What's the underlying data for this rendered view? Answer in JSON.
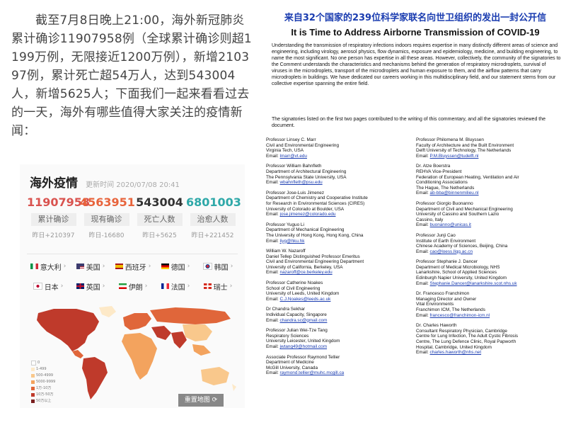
{
  "intro": "截至7月8日晚上21:00，海外新冠肺炎累计确诊11907958例（全球累计确诊则超1199万例，无限接近1200万例），新增210397例，累计死亡超54万人，达到543004人，新增5625人；下面我们一起来看看过去的一天，海外有哪些值得大家关注的疫情新闻：",
  "card": {
    "title": "海外疫情",
    "update_time": "更新时间 2020/07/08 20:41",
    "stats": [
      {
        "value": "11907958",
        "label": "累计确诊",
        "delta": "昨日+210397",
        "color": "#d9534f"
      },
      {
        "value": "4563951",
        "label": "现有确诊",
        "delta": "昨日-16680",
        "color": "#e8643c"
      },
      {
        "value": "543004",
        "label": "死亡人数",
        "delta": "昨日+5625",
        "color": "#333333"
      },
      {
        "value": "6801003",
        "label": "治愈人数",
        "delta": "昨日+221452",
        "color": "#2ea8a8"
      }
    ],
    "countries": [
      "意大利",
      "美国",
      "西班牙",
      "德国",
      "韩国",
      "日本",
      "英国",
      "伊朗",
      "法国",
      "瑞士"
    ],
    "legend": [
      "0",
      "1-499",
      "500-4999",
      "5000-9999",
      "1万-10万",
      "10万-50万",
      "50万以上"
    ],
    "legend_colors": [
      "#ffffff",
      "#fde9c8",
      "#f9c88c",
      "#f3a35e",
      "#e0663a",
      "#bf3a2b",
      "#7a1f1f"
    ],
    "reset_button": "重置地图"
  },
  "letter": {
    "cn_title": "来自32个国家的239位科学家联名向世卫组织的发出一封公开信",
    "en_title": "It is Time to Address Airborne Transmission of COVID-19",
    "abstract": "Understanding the transmission of respiratory infections indoors requires expertise in many distinctly different areas of science and engineering, including virology, aerosol physics, flow dynamics, exposure and epidemiology, medicine, and building engineering, to name the most significant. No one person has expertise in all these areas. However, collectively, the community of the signatories to the Comment understands the characteristics and mechanisms behind the generation of respiratory microdroplets, survival of viruses in the microdroplets, transport of the microdroplets and human exposure to them, and the airflow patterns that carry microdroplets in buildings. We have dedicated our careers working in this multidisciplinary field, and our statement stems from our collective expertise spanning the entire field.",
    "signed_note": "The signatories listed on the first two pages contributed to the writing of this commentary, and all the signatories reviewed the document.",
    "left_col": [
      {
        "name": "Professor Linsey C. Marr",
        "lines": [
          "Civil and Environmental Engineering",
          "Virginia Tech, USA"
        ],
        "email": "lmarr@vt.edu"
      },
      {
        "name": "Professor William Bahnfleth",
        "lines": [
          "Department of Architectural Engineering",
          "The Pennsylvania State University, USA"
        ],
        "email": "wbahnfleth@psu.edu"
      },
      {
        "name": "Professor Jose-Luis Jimenez",
        "lines": [
          "Department of Chemistry and Cooperative Institute",
          "for Research in Environmental Sciences (CIRES)",
          "University of Colorado at Boulder, USA"
        ],
        "email": "jose.jimenez@colorado.edu"
      },
      {
        "name": "Professor Yuguo Li",
        "lines": [
          "Department of Mechanical Engineering",
          "The University of Hong Kong, Hong Kong, China"
        ],
        "email": "liyg@hku.hk"
      },
      {
        "name": "William W. Nazaroff",
        "lines": [
          "Daniel Tellep Distinguished Professor Emeritus",
          "Civil and Environmental Engineering Department",
          "University of California, Berkeley, USA"
        ],
        "email": "nazaroff@ce.berkeley.edu"
      },
      {
        "name": "Professor Catherine Noakes",
        "lines": [
          "School of Civil Engineering",
          "University of Leeds, United Kingdom"
        ],
        "email": "C.J.Noakes@leeds.ac.uk"
      },
      {
        "name": "Dr Chandra Sekhar",
        "lines": [
          "Individual Capacity, Singapore"
        ],
        "email": "chandra.sc@gmail.com"
      },
      {
        "name": "Professor Julian Wei-Tze Tang",
        "lines": [
          "Respiratory Sciences",
          "University Leicester, United Kingdom"
        ],
        "email": "jwtang49@hotmail.com"
      },
      {
        "name": "Associate Professor Raymond Tellier",
        "lines": [
          "Department of Medicine",
          "McGill University, Canada"
        ],
        "email": "raymond.tellier@muhc.mcgill.ca"
      }
    ],
    "right_col": [
      {
        "name": "Professor Philomena M. Bluyssen",
        "lines": [
          "Faculty of Architecture and the Built Environment",
          "Delft University of Technology, The Netherlands"
        ],
        "email": "P.M.Bluyssen@tudelft.nl"
      },
      {
        "name": "Dr. Atze Boerstra",
        "lines": [
          "REHVA Vice-President",
          "Federation of European Heating, Ventilation and Air",
          "Conditioning Associations",
          "The Hague, The Netherlands"
        ],
        "email": "ab-bba@binnenmilieu.nl"
      },
      {
        "name": "Professor Giorgio Buonanno",
        "lines": [
          "Department of Civil and Mechanical Engineering",
          "University of Cassino and Southern Lazio",
          "Cassino, Italy"
        ],
        "email": "buonanno@unicas.it"
      },
      {
        "name": "Professor Junji Cao",
        "lines": [
          "Institute of Earth Environment",
          "Chinese Academy of Sciences, Beijing, China"
        ],
        "email": "cao@loess.llqg.ac.cn"
      },
      {
        "name": "Professor Stephanie J. Dancer",
        "lines": [
          "Department of Medical Microbiology, NHS",
          "Lanarkshire, School of Applied Sciences",
          "Edinburgh Napier University, United Kingdom"
        ],
        "email": "Stephanie.Dancer@lanarkshire.scot.nhs.uk"
      },
      {
        "name": "Dr. Francesco Franchimon",
        "lines": [
          "Managing Director and Owner",
          "Vital Environments",
          "Franchimon ICM, The Netherlands"
        ],
        "email": "francesco@franchimon-icm.nl"
      },
      {
        "name": "Dr. Charles Haworth",
        "lines": [
          "Consultant Respiratory Physician, Cambridge",
          "Centre for Lung Infection, The Adult Cystic Fibrosis",
          "Centre, The Lung Defence Clinic, Royal Papworth",
          "Hospital, Cambridge, United Kingdom"
        ],
        "email": "charles.haworth@nhs.net"
      }
    ]
  }
}
